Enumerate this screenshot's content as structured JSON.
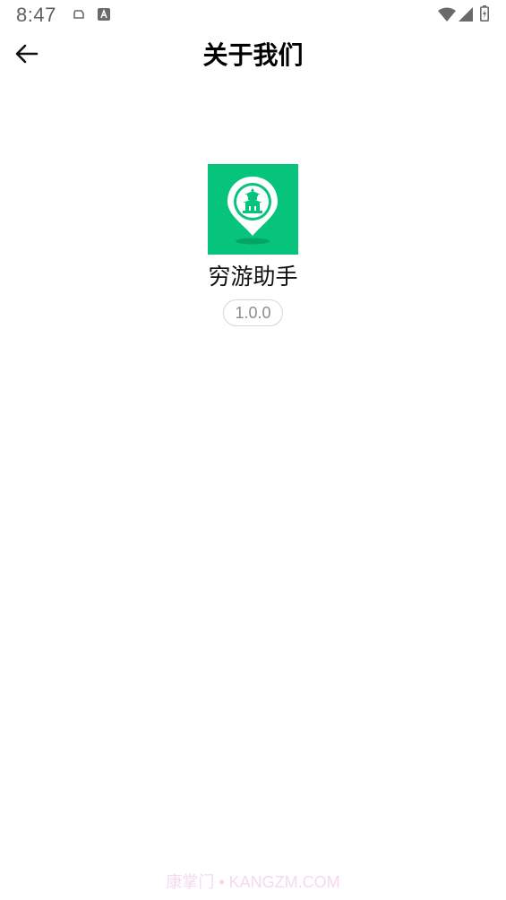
{
  "status_bar": {
    "time": "8:47",
    "icons": [
      "cloud-icon",
      "a-icon",
      "wifi-icon",
      "signal-icon",
      "battery-charging-icon"
    ]
  },
  "app_bar": {
    "back_icon": "arrow-left-icon",
    "title": "关于我们"
  },
  "app_info": {
    "logo_icon": "temple-location-pin-icon",
    "name": "穷游助手",
    "version": "1.0.0"
  },
  "watermark": "康掌门 • KANGZM.COM",
  "colors": {
    "brand_green": "#06c47b",
    "background": "#ffffff",
    "version_text": "#8c8c8c",
    "version_border": "#d6d6d6"
  }
}
